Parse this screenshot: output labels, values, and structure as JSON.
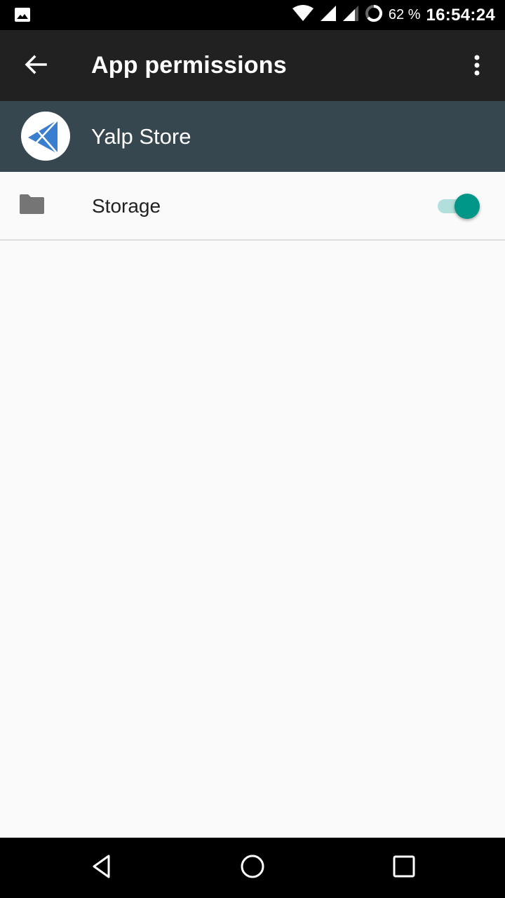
{
  "status_bar": {
    "notification_icon": "image-icon",
    "wifi_icon": "wifi-icon",
    "signal_icons": [
      "signal-full-icon",
      "signal-partial-icon"
    ],
    "battery_icon": "battery-ring-icon",
    "battery_percent": "62 %",
    "time": "16:54:24"
  },
  "app_bar": {
    "back_icon": "arrow-back-icon",
    "title": "App permissions",
    "overflow_icon": "more-vert-icon"
  },
  "app_header": {
    "app_name": "Yalp Store",
    "app_icon": "yalp-store-logo"
  },
  "permissions": [
    {
      "label": "Storage",
      "icon": "folder-icon",
      "enabled": true
    }
  ],
  "colors": {
    "app_bar": "#212121",
    "header": "#37474f",
    "accent": "#009688",
    "track_on": "#b2dfdb"
  },
  "nav_bar": {
    "back": "nav-back-icon",
    "home": "nav-home-icon",
    "recents": "nav-recents-icon"
  }
}
